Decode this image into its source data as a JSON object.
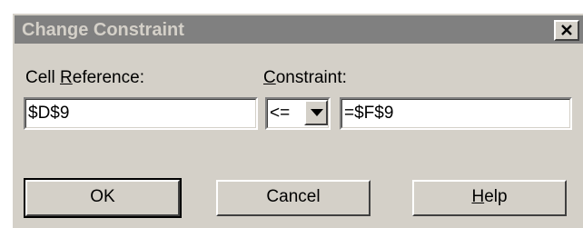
{
  "window": {
    "title": "Change Constraint",
    "close_icon": "close-icon"
  },
  "cell_reference": {
    "label_prefix": "Cell ",
    "label_access": "R",
    "label_suffix": "eference:",
    "value": "$D$9"
  },
  "constraint": {
    "label_access": "C",
    "label_suffix": "onstraint:",
    "operator": "<=",
    "value": "=$F$9",
    "dropdown_icon": "chevron-down-icon"
  },
  "buttons": {
    "ok": "OK",
    "cancel": "Cancel",
    "help_access": "H",
    "help_suffix": "elp"
  },
  "colors": {
    "face": "#d4d0c8",
    "titlebar_inactive": "#808080",
    "title_text": "#d4d0c8"
  }
}
